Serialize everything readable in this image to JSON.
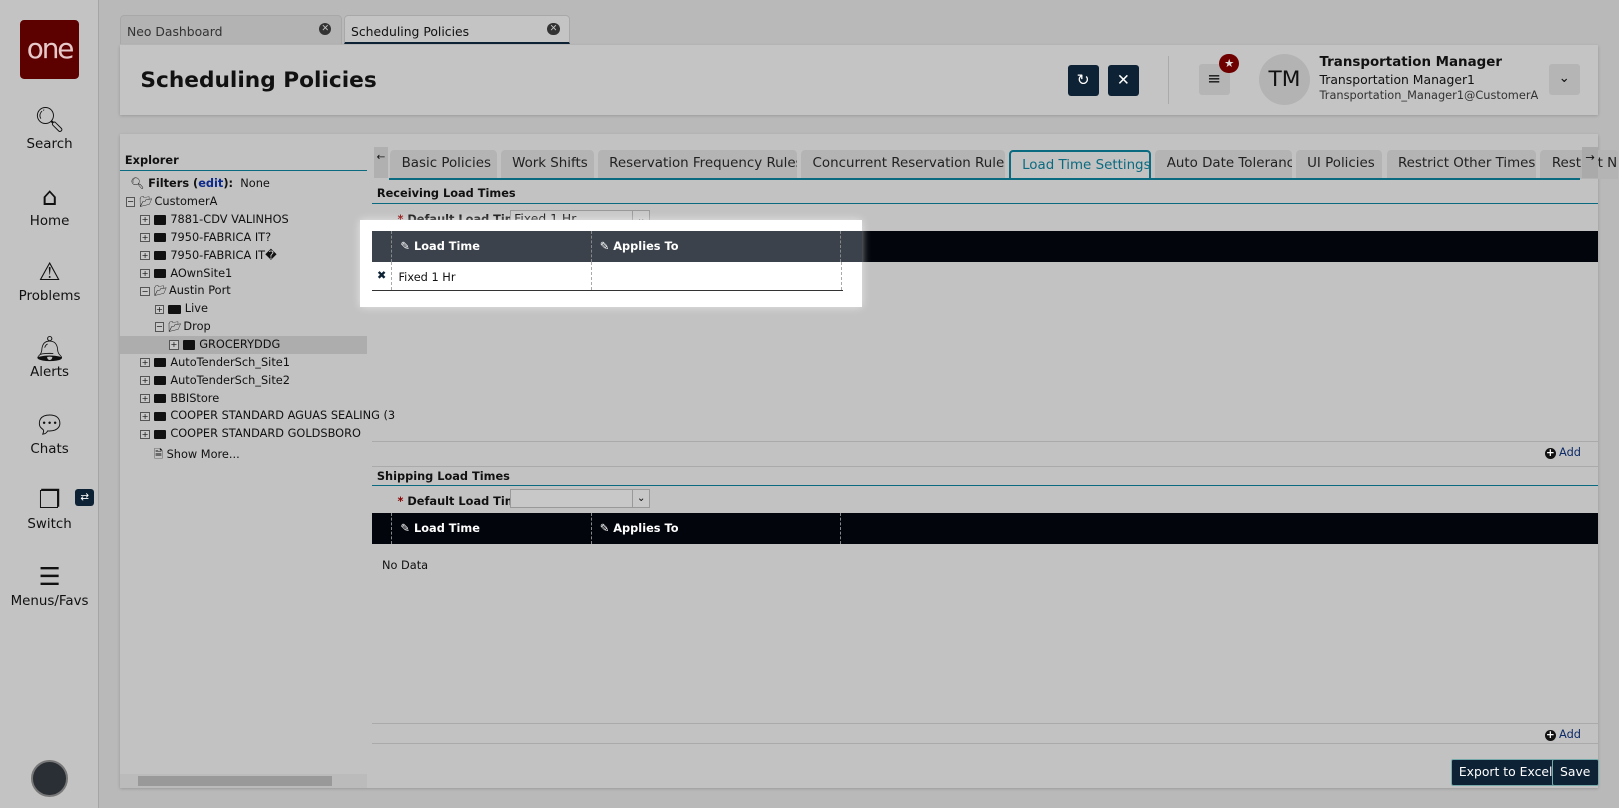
{
  "sidebar": {
    "logo": "one",
    "items": [
      {
        "label": "Search",
        "icon": "search-icon"
      },
      {
        "label": "Home",
        "icon": "home-icon"
      },
      {
        "label": "Problems",
        "icon": "warning-icon"
      },
      {
        "label": "Alerts",
        "icon": "bell-icon"
      },
      {
        "label": "Chats",
        "icon": "chat-icon"
      },
      {
        "label": "Switch",
        "icon": "switch-icon"
      },
      {
        "label": "Menus/Favs",
        "icon": "menu-icon"
      }
    ]
  },
  "window_tabs": [
    {
      "label": "Neo Dashboard"
    },
    {
      "label": "Scheduling Policies",
      "active": true
    }
  ],
  "header": {
    "title": "Scheduling Policies",
    "user": {
      "initials": "TM",
      "name": "Transportation Manager",
      "role": "Transportation Manager1",
      "email": "Transportation_Manager1@CustomerA"
    }
  },
  "explorer": {
    "title": "Explorer",
    "filters_label": "Filters (",
    "filters_edit": "edit",
    "filters_close": "):",
    "filters_value": "None",
    "tree": [
      {
        "label": "CustomerA",
        "level": 0,
        "expanded": true
      },
      {
        "label": "7881-CDV VALINHOS",
        "level": 1
      },
      {
        "label": "7950-FABRICA IT?",
        "level": 1
      },
      {
        "label": "7950-FABRICA IT�",
        "level": 1
      },
      {
        "label": "AOwnSite1",
        "level": 1
      },
      {
        "label": "Austin Port",
        "level": 1,
        "expanded": true
      },
      {
        "label": "Live",
        "level": 2
      },
      {
        "label": "Drop",
        "level": 2,
        "expanded": true
      },
      {
        "label": "GROCERYDDG",
        "level": 3,
        "selected": true
      },
      {
        "label": "AutoTenderSch_Site1",
        "level": 1
      },
      {
        "label": "AutoTenderSch_Site2",
        "level": 1
      },
      {
        "label": "BBIStore",
        "level": 1
      },
      {
        "label": "COOPER STANDARD AGUAS SEALING (3",
        "level": 1
      },
      {
        "label": "COOPER STANDARD GOLDSBORO",
        "level": 1
      }
    ],
    "show_more": "Show More..."
  },
  "tabs": [
    "Basic Policies",
    "Work Shifts",
    "Reservation Frequency Rules",
    "Concurrent Reservation Rules",
    "Load Time Settings",
    "Auto Date Tolerance",
    "UI Policies",
    "Restrict Other Times",
    "Restrict N"
  ],
  "active_tab": "Load Time Settings",
  "receiving": {
    "title": "Receiving Load Times",
    "default_label": "Default Load Time:",
    "default_value": "Fixed 1 Hr",
    "columns": [
      "Load Time",
      "Applies To"
    ],
    "rows": [
      {
        "load_time": "Fixed 1 Hr",
        "applies_to": ""
      }
    ],
    "add": "Add"
  },
  "shipping": {
    "title": "Shipping Load Times",
    "default_label": "Default Load Time:",
    "default_value": "",
    "columns": [
      "Load Time",
      "Applies To"
    ],
    "empty": "No Data",
    "add": "Add"
  },
  "footer": {
    "export": "Export to Excel",
    "save": "Save"
  },
  "colors": {
    "brand": "#5c0000",
    "dark_button": "#0d2235",
    "accent": "#0a6a80"
  }
}
